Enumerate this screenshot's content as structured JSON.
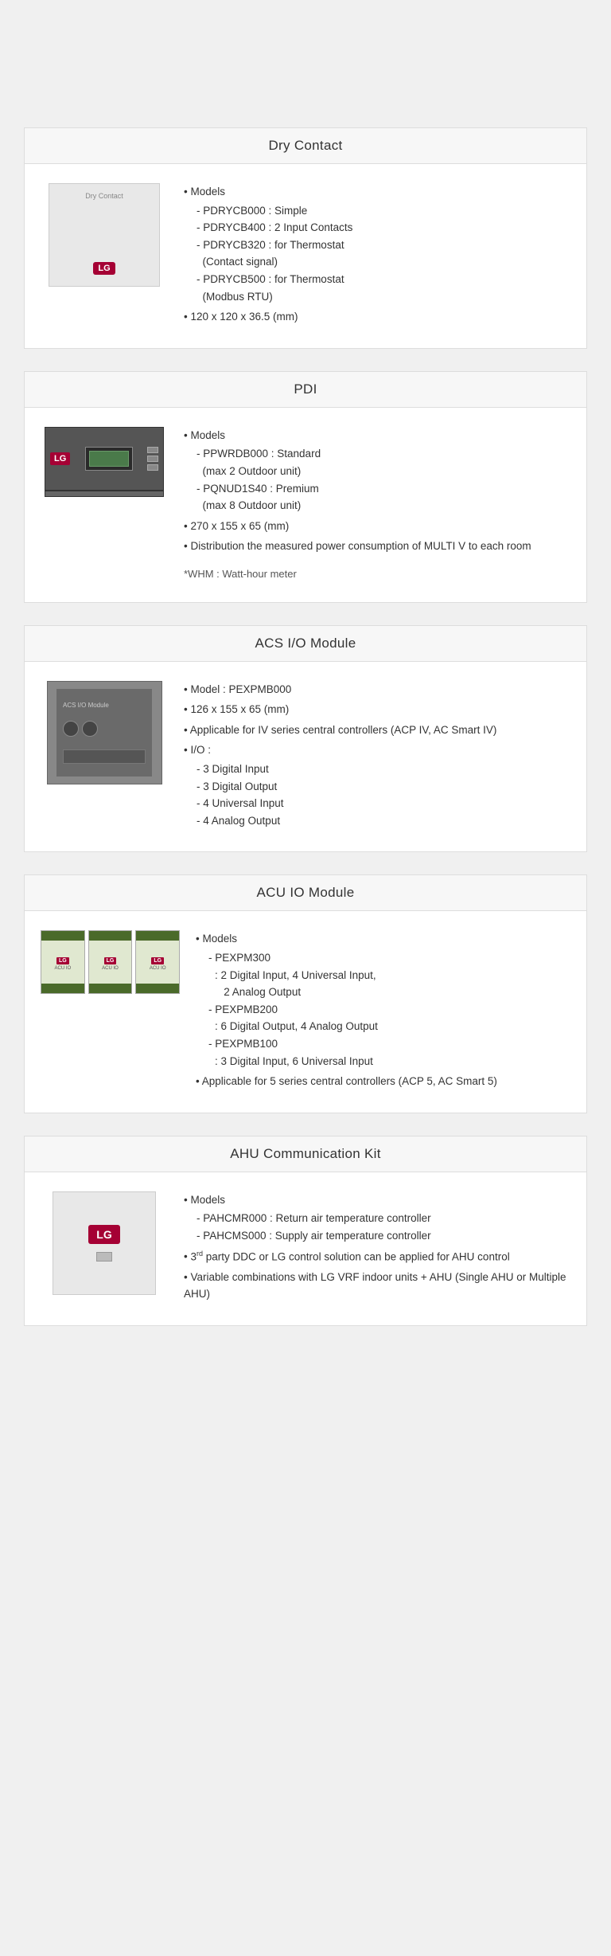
{
  "cards": [
    {
      "id": "dry-contact",
      "title": "Dry Contact",
      "bullets": [
        {
          "text": "Models",
          "sub": [
            "PDRYCB000 : Simple",
            "PDRYCB400 : 2 Input Contacts",
            "PDRYCB320 : for Thermostat (Contact signal)",
            "PDRYCB500 : for Thermostat (Modbus RTU)"
          ]
        },
        {
          "text": "120 x 120 x 36.5 (mm)"
        }
      ],
      "note": null
    },
    {
      "id": "pdi",
      "title": "PDI",
      "bullets": [
        {
          "text": "Models",
          "sub": [
            "PPWRDB000 : Standard (max 2 Outdoor unit)",
            "PQNUD1S40 : Premium (max 8 Outdoor unit)"
          ]
        },
        {
          "text": "270 x 155 x 65 (mm)"
        },
        {
          "text": "Distribution the measured power consumption of MULTI V to each room"
        }
      ],
      "note": "*WHM : Watt-hour meter"
    },
    {
      "id": "acs-io-module",
      "title": "ACS I/O Module",
      "bullets": [
        {
          "text": "Model : PEXPMB000"
        },
        {
          "text": "126 x 155 x 65 (mm)"
        },
        {
          "text": "Applicable for IV series central controllers (ACP IV, AC Smart IV)"
        },
        {
          "text": "I/O :",
          "sub": [
            "3 Digital Input",
            "3 Digital Output",
            "4 Universal Input",
            "4 Analog Output"
          ]
        }
      ],
      "note": null
    },
    {
      "id": "acu-io-module",
      "title": "ACU IO Module",
      "bullets": [
        {
          "text": "Models",
          "sub": [
            "PEXPM300",
            ": 2 Digital Input, 4 Universal Input, 2 Analog Output",
            "PEXPMB200",
            ": 6 Digital Output, 4 Analog Output",
            "PEXPMB100",
            ": 3 Digital Input, 6 Universal Input"
          ]
        },
        {
          "text": "Applicable for 5 series central controllers (ACP 5, AC Smart 5)"
        }
      ],
      "note": null
    },
    {
      "id": "ahu-communication-kit",
      "title": "AHU Communication Kit",
      "bullets": [
        {
          "text": "Models",
          "sub": [
            "PAHCMR000 : Return air temperature controller",
            "PAHCMS000 : Supply air temperature controller"
          ]
        },
        {
          "text": "3rd party DDC or LG control solution can be applied for AHU control"
        },
        {
          "text": "Variable combinations with LG VRF indoor units + AHU (Single AHU or Multiple AHU)"
        }
      ],
      "note": null
    }
  ]
}
